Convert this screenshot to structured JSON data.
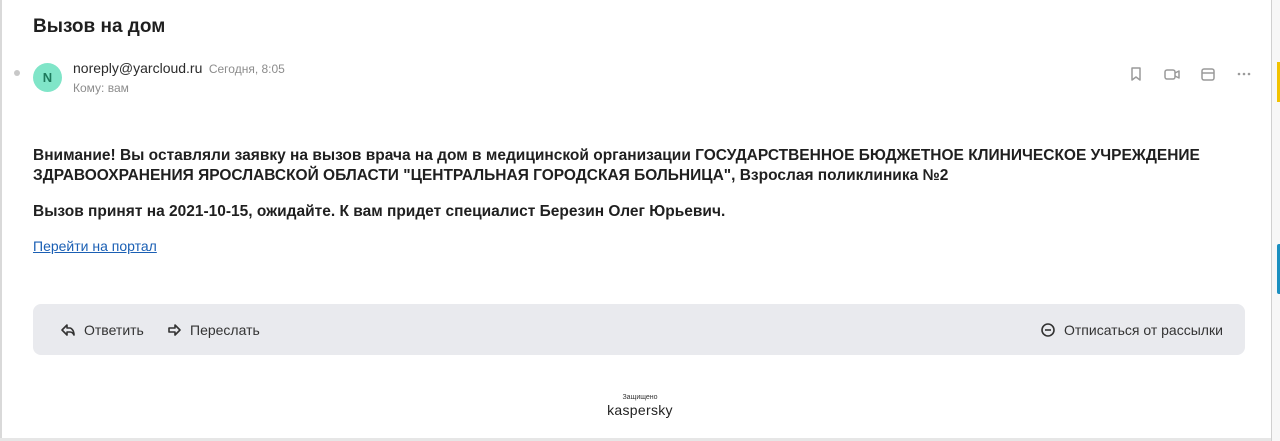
{
  "email": {
    "subject": "Вызов на дом",
    "sender_initial": "N",
    "sender": "noreply@yarcloud.ru",
    "date": "Сегодня, 8:05",
    "to": "Кому: вам",
    "body": {
      "paragraph1": "Внимание! Вы оставляли заявку на вызов врача на дом в медицинской организации ГОСУДАРСТВЕННОЕ БЮДЖЕТНОЕ КЛИНИЧЕСКОЕ УЧРЕЖДЕНИЕ ЗДРАВООХРАНЕНИЯ ЯРОСЛАВСКОЙ ОБЛАСТИ \"ЦЕНТРАЛЬНАЯ ГОРОДСКАЯ БОЛЬНИЦА\", Взрослая поликлиника №2",
      "paragraph2": "Вызов принят на 2021-10-15, ожидайте. К вам придет специалист Березин Олег Юрьевич.",
      "link": "Перейти на портал"
    }
  },
  "header_icons": [
    "bookmark-icon",
    "video-icon",
    "calendar-icon",
    "more-icon"
  ],
  "actions": {
    "reply": "Ответить",
    "forward": "Переслать",
    "unsubscribe": "Отписаться от рассылки"
  },
  "footer": {
    "protected": "Защищено",
    "brand": "kaspersky"
  },
  "colors": {
    "avatar_bg": "#80e5c8",
    "link": "#1a5fb4",
    "action_bar_bg": "#e9eaee"
  }
}
